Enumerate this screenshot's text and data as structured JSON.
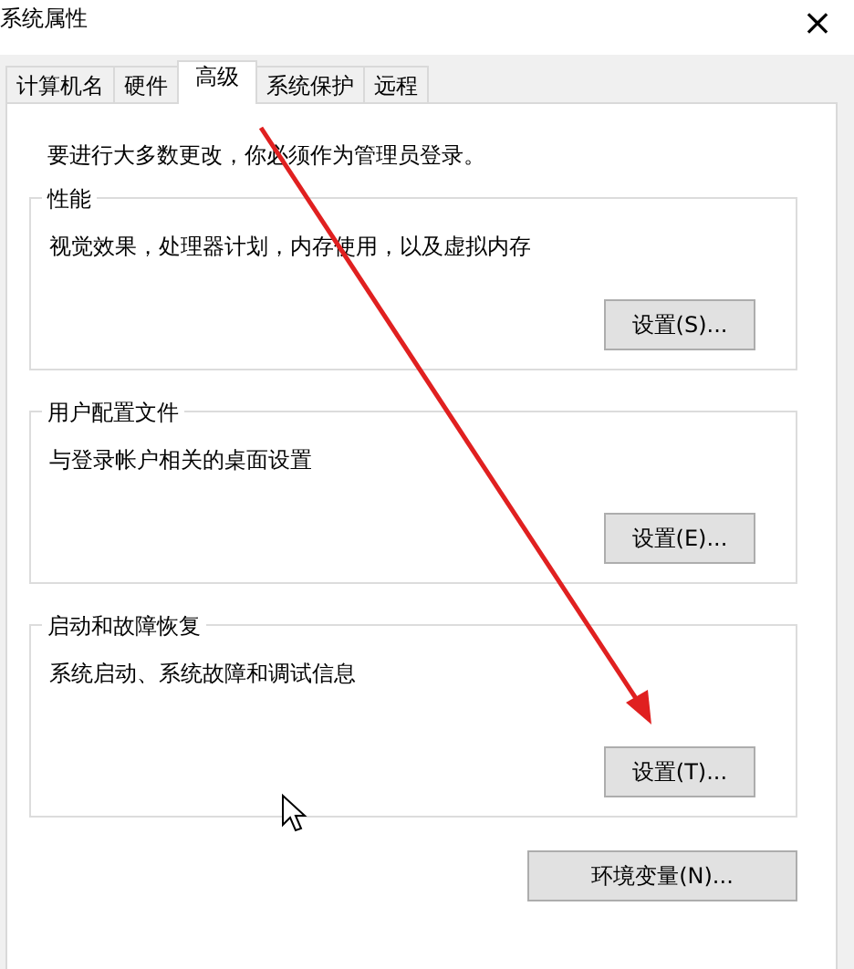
{
  "window": {
    "title": "系统属性",
    "close": "×"
  },
  "tabs": [
    {
      "label": "计算机名",
      "selected": false
    },
    {
      "label": "硬件",
      "selected": false
    },
    {
      "label": "高级",
      "selected": true
    },
    {
      "label": "系统保护",
      "selected": false
    },
    {
      "label": "远程",
      "selected": false
    }
  ],
  "notice": "要进行大多数更改，你必须作为管理员登录。",
  "groups": [
    {
      "title": "性能",
      "description": "视觉效果，处理器计划，内存使用，以及虚拟内存",
      "button": "设置(S)..."
    },
    {
      "title": "用户配置文件",
      "description": "与登录帐户相关的桌面设置",
      "button": "设置(E)..."
    },
    {
      "title": "启动和故障恢复",
      "description": "系统启动、系统故障和调试信息",
      "button": "设置(T)..."
    }
  ],
  "env_button": "环境变量(N)..."
}
